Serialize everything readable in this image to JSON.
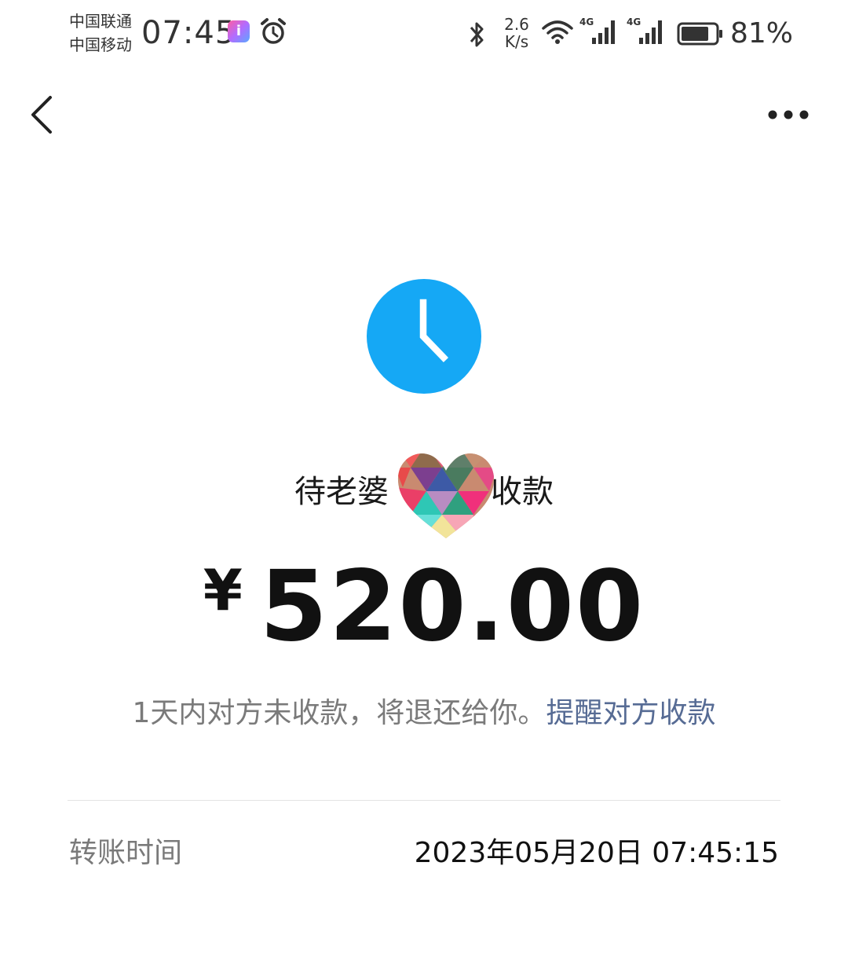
{
  "status_bar": {
    "carrier_1": "中国联通",
    "carrier_2": "中国移动",
    "time": "07:45",
    "net_speed_value": "2.6",
    "net_speed_unit": "K/s",
    "signal_1_label": "4G",
    "signal_2_label": "4G",
    "battery_percent": "81%",
    "battery_level": 0.81
  },
  "nav": {
    "back_icon": "chevron-left-icon",
    "more_icon": "more-dots-icon"
  },
  "transfer": {
    "status_icon": "clock-icon",
    "status_color": "#15a8f5",
    "status_prefix": "待老婆",
    "status_suffix": "收款",
    "currency_symbol": "¥",
    "amount": "520.00",
    "notice_text": "1天内对方未收款，将退还给你。",
    "remind_link": "提醒对方收款",
    "link_color": "#566b94"
  },
  "details": {
    "transfer_time_label": "转账时间",
    "transfer_time_value": "2023年05月20日 07:45:15"
  }
}
